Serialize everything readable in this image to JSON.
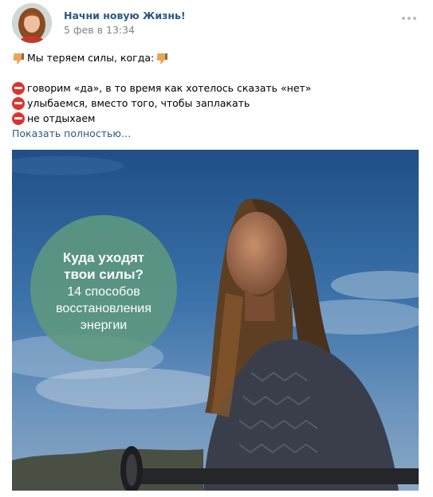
{
  "post": {
    "author": "Начни новую Жизнь!",
    "date": "5 фев в 13:34",
    "text": {
      "intro": "Мы теряем силы, когда:",
      "items": [
        "говорим «да», в то время как хотелось сказать «нет»",
        "улыбаемся, вместо того, чтобы заплакать",
        "не отдыхаем"
      ]
    },
    "show_more": "Показать полностью…",
    "image": {
      "badge_title_1": "Куда уходят",
      "badge_title_2": "твои силы?",
      "badge_sub_1": "14 способов",
      "badge_sub_2": "восстановления",
      "badge_sub_3": "энергии"
    }
  },
  "icons": {
    "thumb": "thumbs-down-icon",
    "stop": "no-entry-icon",
    "more": "more-dots-icon"
  },
  "colors": {
    "link": "#2a5885",
    "meta": "#828282",
    "badge": "#5f987e",
    "stop": "#e0322d"
  }
}
